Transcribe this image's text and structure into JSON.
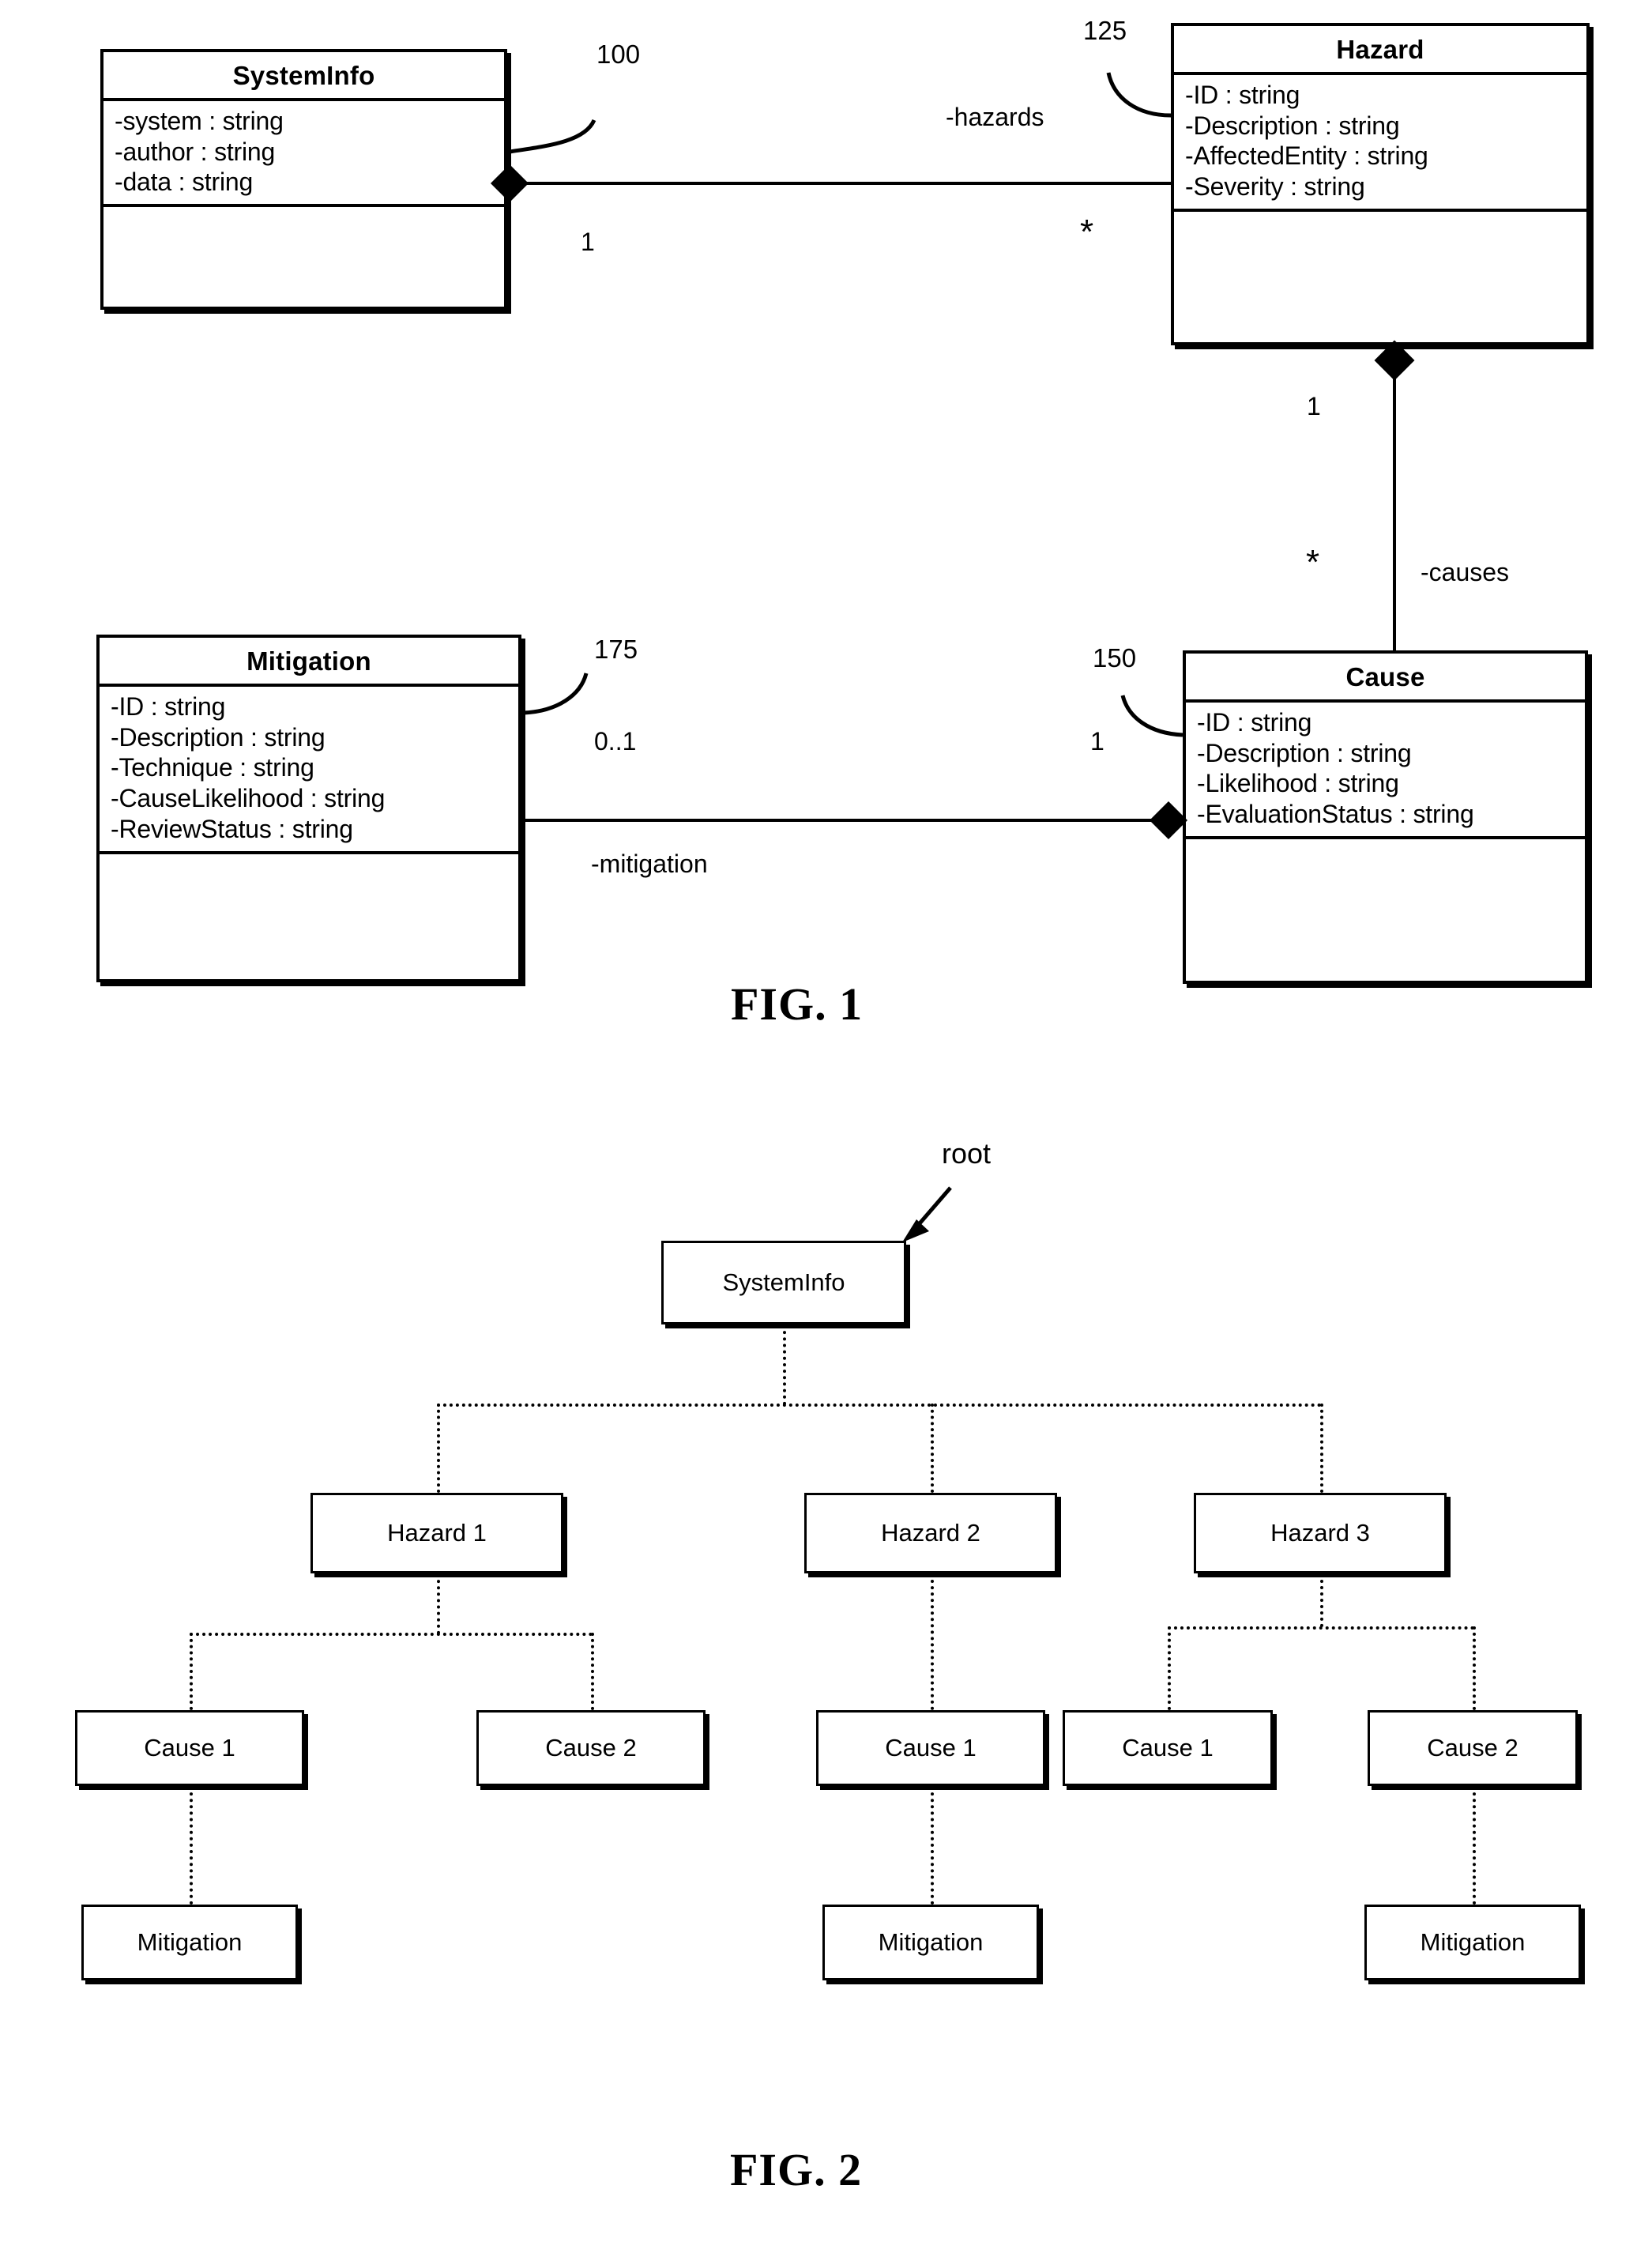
{
  "figure1": {
    "caption": "FIG. 1",
    "classes": [
      {
        "id": "systeminfo",
        "name": "SystemInfo",
        "ref": "100",
        "attributes": [
          "-system : string",
          "-author : string",
          "-data : string"
        ]
      },
      {
        "id": "hazard",
        "name": "Hazard",
        "ref": "125",
        "attributes": [
          "-ID : string",
          "-Description : string",
          "-AffectedEntity : string",
          "-Severity : string"
        ]
      },
      {
        "id": "mitigation",
        "name": "Mitigation",
        "ref": "175",
        "attributes": [
          "-ID : string",
          "-Description : string",
          "-Technique : string",
          "-CauseLikelihood : string",
          "-ReviewStatus : string"
        ]
      },
      {
        "id": "cause",
        "name": "Cause",
        "ref": "150",
        "attributes": [
          "-ID : string",
          "-Description : string",
          "-Likelihood : string",
          "-EvaluationStatus : string"
        ]
      }
    ],
    "associations": [
      {
        "id": "systeminfo-hazard",
        "role": "-hazards",
        "source_multiplicity": "1",
        "target_multiplicity": "*"
      },
      {
        "id": "hazard-cause",
        "role": "-causes",
        "source_multiplicity": "1",
        "target_multiplicity": "*"
      },
      {
        "id": "cause-mitigation",
        "role": "-mitigation",
        "source_multiplicity": "1",
        "target_multiplicity": "0..1"
      }
    ]
  },
  "figure2": {
    "caption": "FIG. 2",
    "root_label": "root",
    "root": "SystemInfo",
    "hazards": [
      "Hazard 1",
      "Hazard 2",
      "Hazard 3"
    ],
    "causes_row": [
      "Cause 1",
      "Cause 2",
      "Cause 1",
      "Cause 1",
      "Cause 2"
    ],
    "mitigations_row": [
      "Mitigation",
      "Mitigation",
      "Mitigation"
    ]
  }
}
